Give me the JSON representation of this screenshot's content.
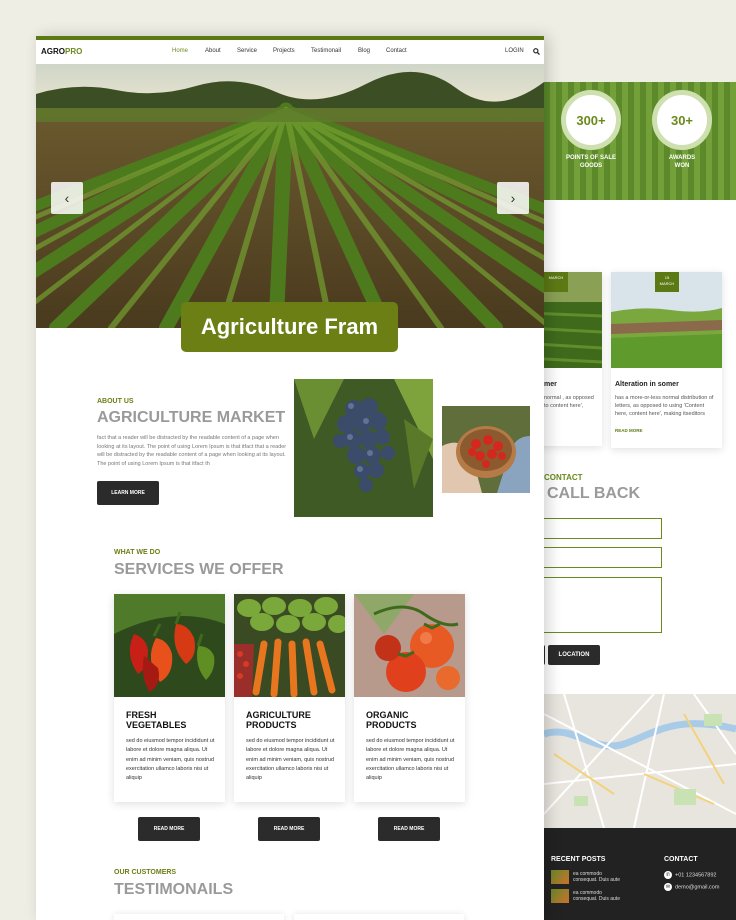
{
  "nav": {
    "logo_a": "AGRO",
    "logo_b": "PRO",
    "links": [
      "Home",
      "About",
      "Service",
      "Projects",
      "Testimonail",
      "Blog",
      "Contact"
    ],
    "login": "LOGIN"
  },
  "hero": {
    "title": "Agriculture Fram"
  },
  "about": {
    "eyebrow": "ABOUT US",
    "title": "AGRICULTURE MARKET",
    "text": "fact that a reader will be distracted by the readable content of a page when looking at its layout. The point of using Lorem Ipsum is that itfact that a reader will be distracted by the readable content of a page when looking at its layout. The point of using Lorem Ipsum is that itfact th",
    "button": "LEARN MORE"
  },
  "services": {
    "eyebrow": "WHAT WE DO",
    "title": "SERVICES WE OFFER",
    "items": [
      {
        "name_1": "FRESH",
        "name_2": "VEGETABLES",
        "desc": "sed do eiusmod tempor incididunt ut labore et dolore magna aliqua. Ut enim ad minim veniam, quis nostrud exercitation ullamco laboris nisi ut aliquip",
        "button": "READ MORE"
      },
      {
        "name_1": "AGRICULTURE",
        "name_2": "PRODUCTS",
        "desc": "sed do eiusmod tempor incididunt ut labore et dolore magna aliqua. Ut enim ad minim veniam, quis nostrud exercitation ullamco laboris nisi ut aliquip",
        "button": "READ MORE"
      },
      {
        "name_1": "ORGANIC",
        "name_2": "PRODUCTS",
        "desc": "sed do eiusmod tempor incididunt ut labore et dolore magna aliqua. Ut enim ad minim veniam, quis nostrud exercitation ullamco laboris nisi ut aliquip",
        "button": "READ MORE"
      }
    ]
  },
  "testimonials": {
    "eyebrow": "OUR CUSTOMERS",
    "title": "TESTIMONAILS"
  },
  "stats": [
    {
      "value": "300+",
      "label_1": "POINTS OF SALE",
      "label_2": "GOODS"
    },
    {
      "value": "30+",
      "label_1": "AWARDS",
      "label_2": "WON"
    }
  ],
  "blog": [
    {
      "date": "MARCH",
      "title": "mer",
      "desc": "normal , as opposed to content here',",
      "more": ""
    },
    {
      "date_day": "15",
      "date": "MARCH",
      "title": "Alteration in somer",
      "desc": "has a more-or-less normal distribution of letters, as opposed to using 'Content here, content here', making itseditors",
      "more": "READ MORE"
    }
  ],
  "contact": {
    "eyebrow": "CONTACT",
    "title": "CALL BACK",
    "location_button": "LOCATION"
  },
  "footer": {
    "recent_title": "RECENT POSTS",
    "posts": [
      {
        "line_1": "ea commodo",
        "line_2": "consequat. Duis aute"
      },
      {
        "line_1": "ea commodo",
        "line_2": "consequat. Duis aute"
      }
    ],
    "contact_title": "CONTACT",
    "phone": "+01 1234567892",
    "email": "demo@gmail.com"
  },
  "colors": {
    "brand_green": "#6b7f14",
    "dark_button": "#2b2b2b",
    "footer_bg": "#222222"
  }
}
